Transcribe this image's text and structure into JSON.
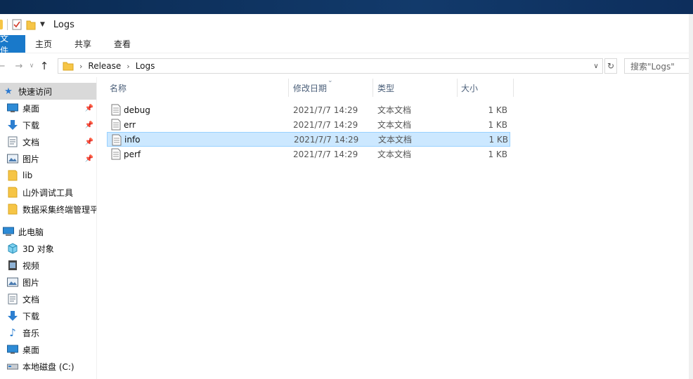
{
  "window": {
    "title": "Logs"
  },
  "ribbon": {
    "tabs": [
      "文件",
      "主页",
      "共享",
      "查看"
    ]
  },
  "address": {
    "crumbs": [
      "Release",
      "Logs"
    ],
    "search_placeholder": "搜索\"Logs\""
  },
  "sidebar": {
    "quick_access": {
      "label": "快速访问",
      "items": [
        {
          "label": "桌面",
          "icon": "desktop-icon",
          "pinned": true
        },
        {
          "label": "下载",
          "icon": "download-icon",
          "pinned": true
        },
        {
          "label": "文档",
          "icon": "document-icon",
          "pinned": true
        },
        {
          "label": "图片",
          "icon": "pictures-icon",
          "pinned": true
        },
        {
          "label": "lib",
          "icon": "folder-icon",
          "pinned": false
        },
        {
          "label": "山外调试工具",
          "icon": "folder-icon",
          "pinned": false
        },
        {
          "label": "数据采集终端管理平",
          "icon": "folder-icon",
          "pinned": false
        }
      ]
    },
    "this_pc": {
      "label": "此电脑",
      "items": [
        {
          "label": "3D 对象",
          "icon": "3d-objects-icon"
        },
        {
          "label": "视频",
          "icon": "video-icon"
        },
        {
          "label": "图片",
          "icon": "pictures-icon"
        },
        {
          "label": "文档",
          "icon": "document-icon"
        },
        {
          "label": "下载",
          "icon": "download-icon"
        },
        {
          "label": "音乐",
          "icon": "music-icon"
        },
        {
          "label": "桌面",
          "icon": "desktop-icon"
        },
        {
          "label": "本地磁盘 (C:)",
          "icon": "drive-icon"
        }
      ]
    }
  },
  "file_list": {
    "columns": [
      "名称",
      "修改日期",
      "类型",
      "大小"
    ],
    "rows": [
      {
        "name": "debug",
        "date": "2021/7/7 14:29",
        "type": "文本文档",
        "size": "1 KB",
        "selected": false
      },
      {
        "name": "err",
        "date": "2021/7/7 14:29",
        "type": "文本文档",
        "size": "1 KB",
        "selected": false
      },
      {
        "name": "info",
        "date": "2021/7/7 14:29",
        "type": "文本文档",
        "size": "1 KB",
        "selected": true
      },
      {
        "name": "perf",
        "date": "2021/7/7 14:29",
        "type": "文本文档",
        "size": "1 KB",
        "selected": false
      }
    ]
  },
  "colors": {
    "accent": "#1979ca",
    "selection_bg": "#cce8ff",
    "selection_border": "#99d1ff",
    "title_strip": "#0d2e5c",
    "folder": "#f6c546"
  }
}
